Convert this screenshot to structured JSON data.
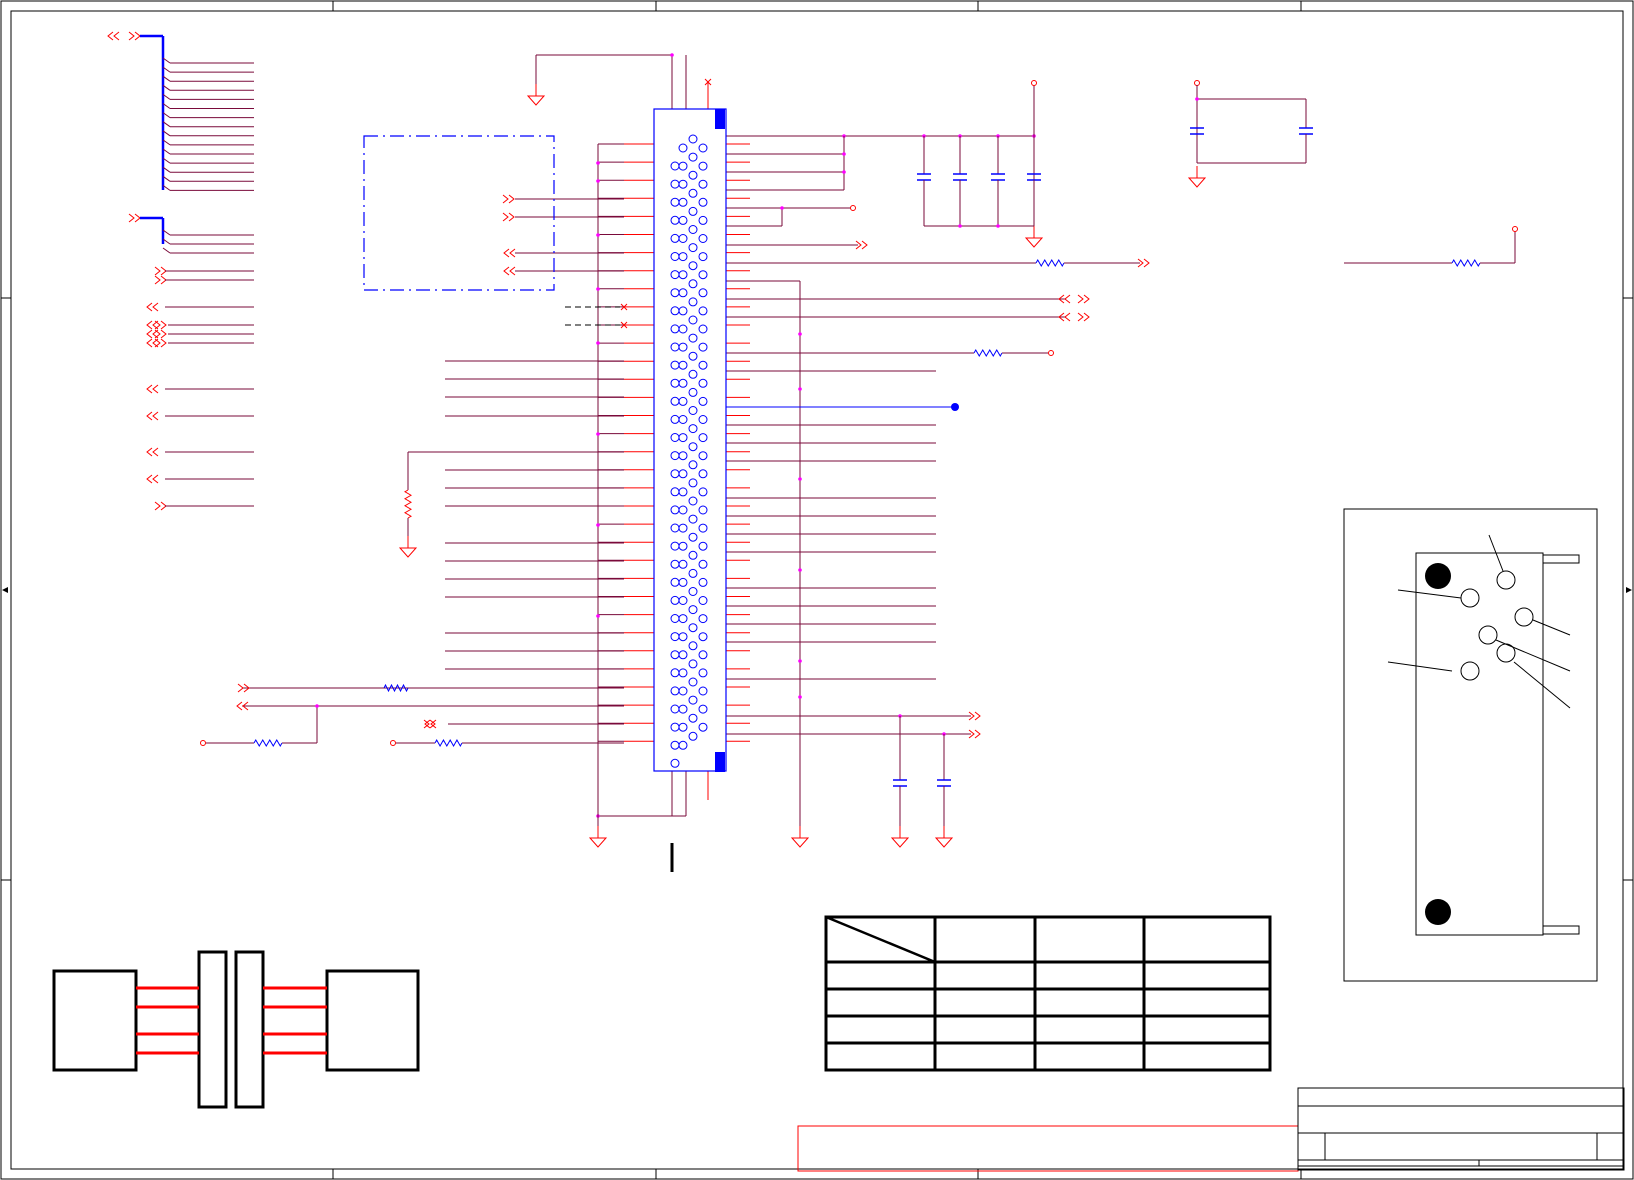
{
  "sheet": {
    "type": "schematic",
    "border_color": "#000000",
    "wire_color": "#7a0a3a",
    "bus_color": "#0000ff",
    "pin_color": "#ff0000",
    "junction_color": "#ff00ff",
    "component_color": "#0000ff",
    "ground_color": "#ff0000"
  },
  "visible_text": {
    "title_block_text": "",
    "connector_designator": "",
    "table_header": "",
    "notes": ""
  },
  "table": {
    "rows": 5,
    "cols": 4,
    "cells": [
      [
        "",
        "",
        "",
        ""
      ],
      [
        "",
        "",
        "",
        ""
      ],
      [
        "",
        "",
        "",
        ""
      ],
      [
        "",
        "",
        "",
        ""
      ],
      [
        "",
        "",
        "",
        ""
      ]
    ]
  },
  "icons": {
    "net_port": "double-chevron-icon",
    "ground": "ground-symbol-icon",
    "resistor": "resistor-icon",
    "capacitor": "capacitor-icon",
    "power_pin": "open-circle-pin-icon",
    "no_connect": "x-mark-icon"
  }
}
